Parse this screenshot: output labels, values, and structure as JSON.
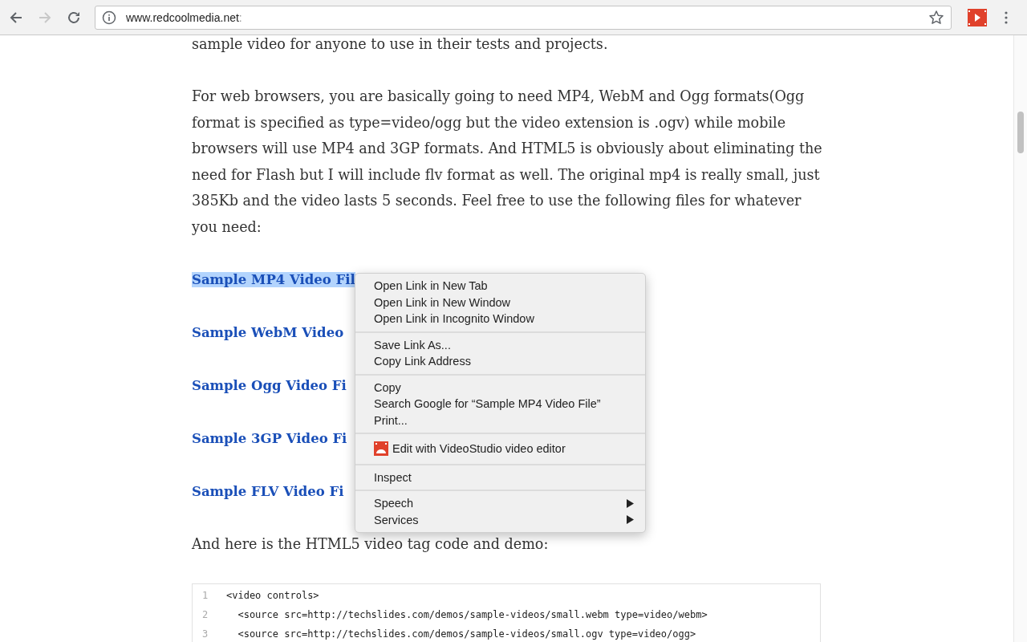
{
  "toolbar": {
    "url_host": "www.redcoolmedia.net",
    "url_rest": ":"
  },
  "article": {
    "intro": "sample video for anyone to use in their tests and projects.",
    "paragraph": "For web browsers, you are basically going to need MP4, WebM and Ogg formats(Ogg format is specified as type=video/ogg but the video extension is .ogv) while mobile browsers will use MP4 and 3GP formats. And HTML5 is obviously about eliminating the need for Flash but I will include flv format as well. The original mp4 is really small, just 385Kb and the video lasts 5 seconds. Feel free to use the following files for whatever you need:",
    "links": [
      {
        "label": "Sample MP4 Video Fil",
        "highlighted": true
      },
      {
        "label": "Sample WebM Video",
        "highlighted": false
      },
      {
        "label": "Sample Ogg Video Fi",
        "highlighted": false
      },
      {
        "label": "Sample 3GP Video Fi",
        "highlighted": false
      },
      {
        "label": "Sample FLV Video Fi",
        "highlighted": false
      }
    ],
    "outro": "And here is the HTML5 video tag code and demo:",
    "code_lines": [
      {
        "number": "1",
        "text": "<video controls>"
      },
      {
        "number": "2",
        "text": "  <source src=http://techslides.com/demos/sample-videos/small.webm type=video/webm>"
      },
      {
        "number": "3",
        "text": "  <source src=http://techslides.com/demos/sample-videos/small.ogv type=video/ogg>"
      }
    ]
  },
  "context_menu": {
    "groups": [
      [
        {
          "label": "Open Link in New Tab",
          "kind": "plain"
        },
        {
          "label": "Open Link in New Window",
          "kind": "plain"
        },
        {
          "label": "Open Link in Incognito Window",
          "kind": "plain"
        }
      ],
      [
        {
          "label": "Save Link As...",
          "kind": "plain"
        },
        {
          "label": "Copy Link Address",
          "kind": "plain"
        }
      ],
      [
        {
          "label": "Copy",
          "kind": "plain"
        },
        {
          "label": "Search Google for “Sample MP4 Video File”",
          "kind": "plain"
        },
        {
          "label": "Print...",
          "kind": "plain"
        }
      ],
      [
        {
          "label": "Edit with VideoStudio video editor",
          "kind": "app"
        }
      ],
      [
        {
          "label": "Inspect",
          "kind": "plain"
        }
      ],
      [
        {
          "label": "Speech",
          "kind": "submenu"
        },
        {
          "label": "Services",
          "kind": "submenu"
        }
      ]
    ]
  }
}
